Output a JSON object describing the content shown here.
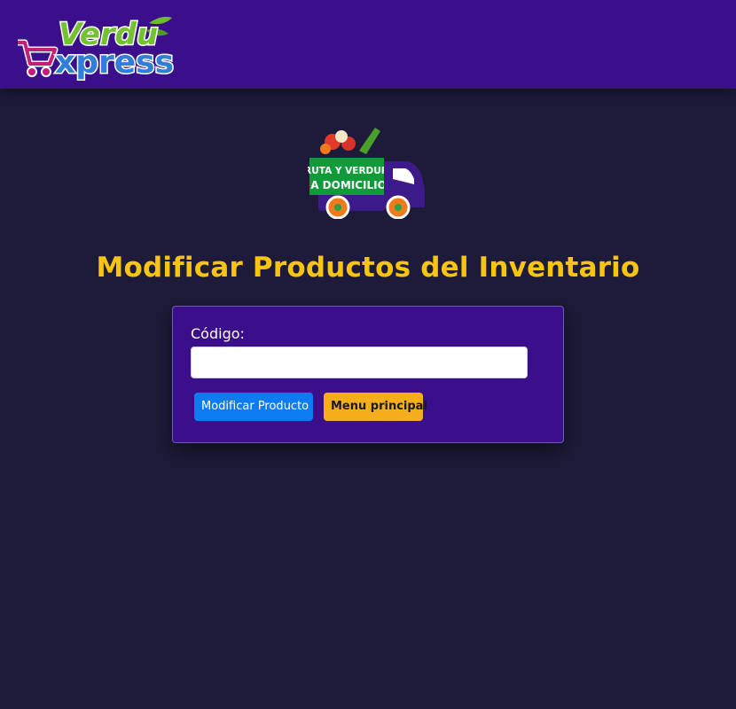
{
  "header": {
    "logo_top_text": "Verdu",
    "logo_bottom_text": "xpress"
  },
  "hero": {
    "truck_line1": "FRUTA Y VERDURA",
    "truck_line2": "A DOMICILIO"
  },
  "page": {
    "title": "Modificar Productos del Inventario"
  },
  "form": {
    "code_label": "Código:",
    "code_value": "",
    "modify_button": "Modificar Producto",
    "menu_button": "Menu principal"
  },
  "colors": {
    "header_bg": "#3b0f8c",
    "page_bg": "#1e1b3a",
    "title": "#f7c410",
    "primary_button": "#0d7cf2",
    "warning_button": "#f6ad1a"
  }
}
